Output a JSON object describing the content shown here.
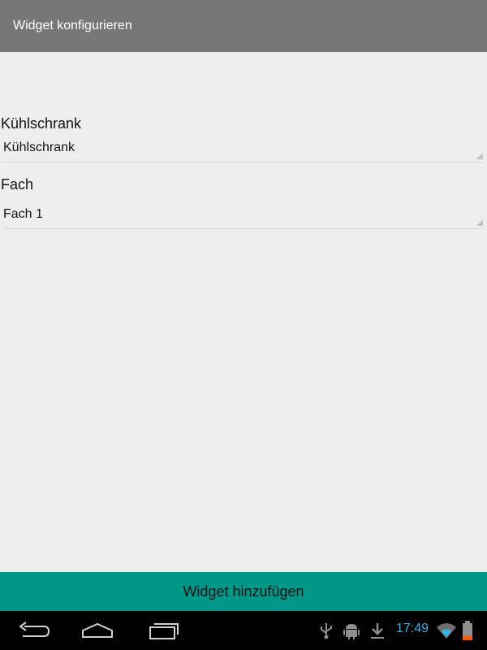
{
  "title_bar": {
    "title": "Widget konfigurieren"
  },
  "form": {
    "fridge": {
      "label": "Kühlschrank",
      "selected_value": "Kühlschrank"
    },
    "compartment": {
      "label": "Fach",
      "selected_value": "Fach 1"
    }
  },
  "actions": {
    "add_button_label": "Widget hinzufügen"
  },
  "system_bar": {
    "nav_icons": [
      "back-icon",
      "home-icon",
      "recent-apps-icon"
    ],
    "status_icons": [
      "usb-icon",
      "android-debug-icon",
      "download-icon",
      "wifi-icon",
      "battery-icon"
    ],
    "clock": "17:49"
  },
  "colors": {
    "title_bar": "#777777",
    "background": "#eeeeee",
    "accent_button": "#009688",
    "clock": "#33b5e5",
    "battery_low": "#ff5a00"
  }
}
